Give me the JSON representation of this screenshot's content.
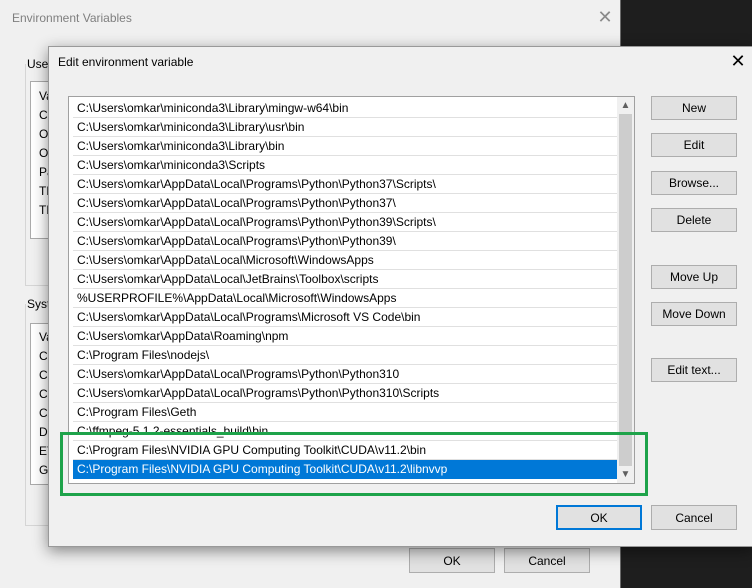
{
  "background_window": {
    "title": "Environment Variables",
    "user_group_label": "User",
    "user_fragments": [
      "Va",
      "Ch",
      "On",
      "On",
      "Pa",
      "TE",
      "TM"
    ],
    "system_group_label": "Syste",
    "system_fragments": [
      "Va",
      "Ch",
      "Co",
      "CU",
      "CU",
      "Dr",
      "ET",
      "GI"
    ],
    "ok_label": "OK",
    "cancel_label": "Cancel"
  },
  "dialog": {
    "title": "Edit environment variable",
    "paths": [
      "C:\\Users\\omkar\\miniconda3\\Library\\mingw-w64\\bin",
      "C:\\Users\\omkar\\miniconda3\\Library\\usr\\bin",
      "C:\\Users\\omkar\\miniconda3\\Library\\bin",
      "C:\\Users\\omkar\\miniconda3\\Scripts",
      "C:\\Users\\omkar\\AppData\\Local\\Programs\\Python\\Python37\\Scripts\\",
      "C:\\Users\\omkar\\AppData\\Local\\Programs\\Python\\Python37\\",
      "C:\\Users\\omkar\\AppData\\Local\\Programs\\Python\\Python39\\Scripts\\",
      "C:\\Users\\omkar\\AppData\\Local\\Programs\\Python\\Python39\\",
      "C:\\Users\\omkar\\AppData\\Local\\Microsoft\\WindowsApps",
      "C:\\Users\\omkar\\AppData\\Local\\JetBrains\\Toolbox\\scripts",
      "%USERPROFILE%\\AppData\\Local\\Microsoft\\WindowsApps",
      "C:\\Users\\omkar\\AppData\\Local\\Programs\\Microsoft VS Code\\bin",
      "C:\\Users\\omkar\\AppData\\Roaming\\npm",
      "C:\\Program Files\\nodejs\\",
      "C:\\Users\\omkar\\AppData\\Local\\Programs\\Python\\Python310",
      "C:\\Users\\omkar\\AppData\\Local\\Programs\\Python\\Python310\\Scripts",
      "C:\\Program Files\\Geth",
      "C:\\ffmpeg-5.1.2-essentials_build\\bin",
      "C:\\Program Files\\NVIDIA GPU Computing Toolkit\\CUDA\\v11.2\\bin",
      "C:\\Program Files\\NVIDIA GPU Computing Toolkit\\CUDA\\v11.2\\libnvvp"
    ],
    "selected_index": 19,
    "buttons": {
      "new": "New",
      "edit": "Edit",
      "browse": "Browse...",
      "delete": "Delete",
      "move_up": "Move Up",
      "move_down": "Move Down",
      "edit_text": "Edit text...",
      "ok": "OK",
      "cancel": "Cancel"
    }
  },
  "icons": {
    "close": "close-icon",
    "scroll_up": "chevron-up-icon",
    "scroll_down": "chevron-down-icon"
  },
  "colors": {
    "selection": "#0078d7",
    "highlight_box": "#1ea34a",
    "dialog_bg": "#f0f0f0"
  }
}
